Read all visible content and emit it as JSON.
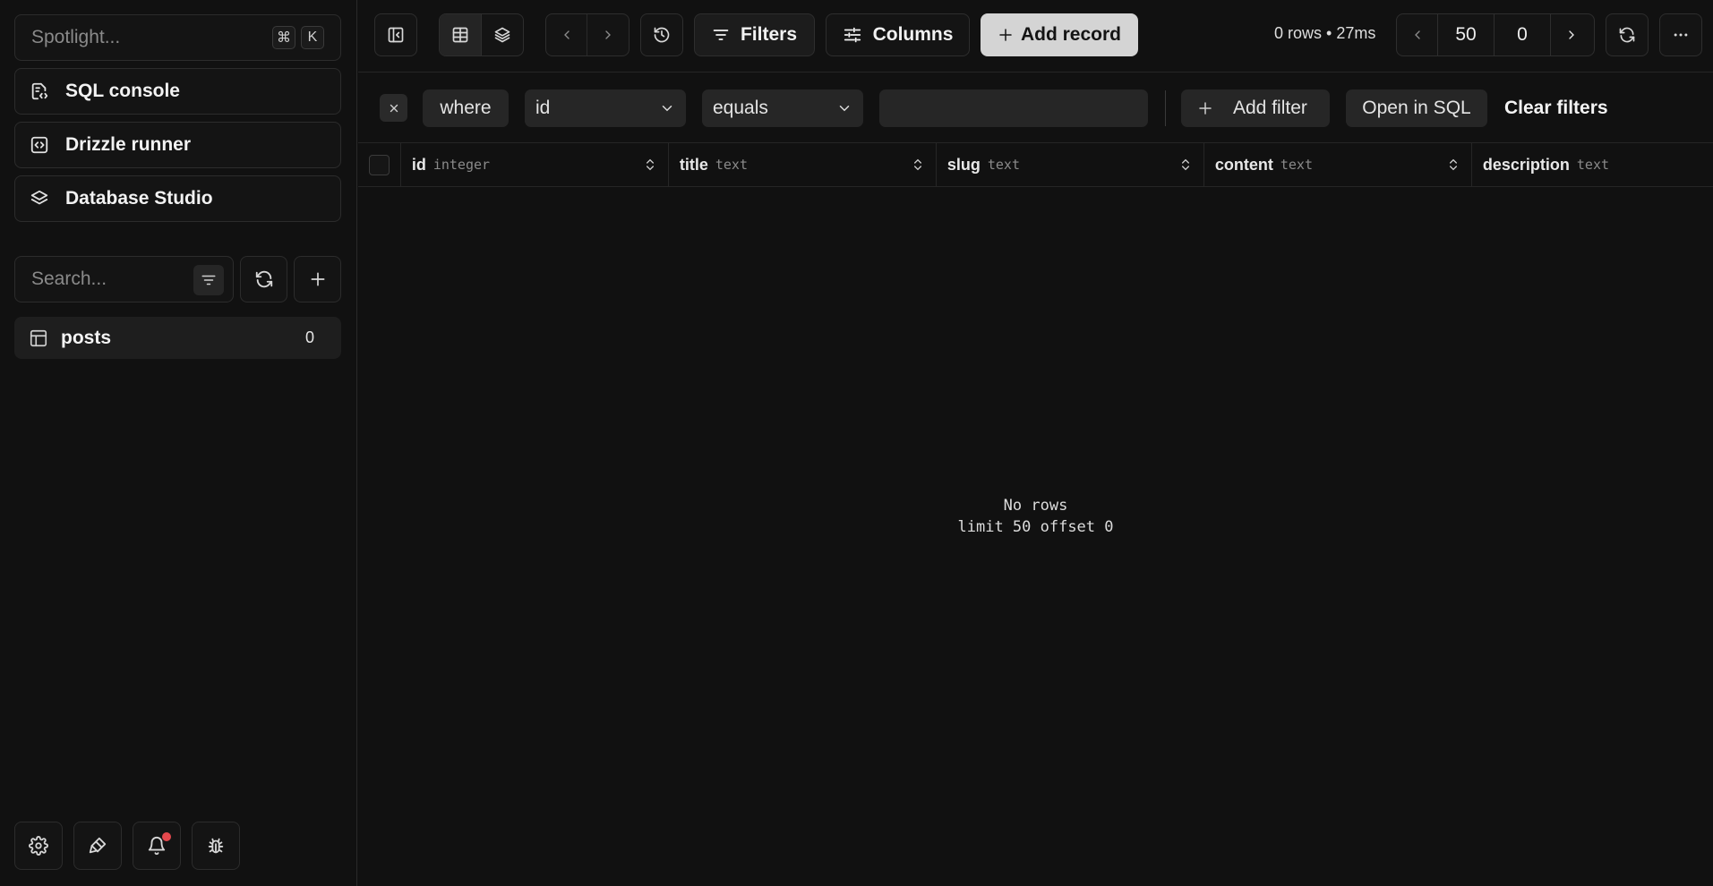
{
  "sidebar": {
    "spotlight": {
      "placeholder": "Spotlight...",
      "kbd_mod": "⌘",
      "kbd_key": "K"
    },
    "nav": {
      "sql_console": "SQL console",
      "drizzle_runner": "Drizzle runner",
      "database_studio": "Database Studio"
    },
    "search": {
      "placeholder": "Search..."
    },
    "tables": [
      {
        "name": "posts",
        "count": "0"
      }
    ],
    "footer_icons": [
      "gear-icon",
      "brush-icon",
      "bell-icon",
      "bug-icon"
    ]
  },
  "toolbar": {
    "filters_label": "Filters",
    "columns_label": "Columns",
    "add_record_label": "Add record",
    "rows_info": "0 rows • 27ms",
    "limit": "50",
    "offset": "0"
  },
  "filter": {
    "where_label": "where",
    "column": "id",
    "operator": "equals",
    "value": "",
    "add_filter_label": "Add filter",
    "open_sql_label": "Open in SQL",
    "clear_label": "Clear filters"
  },
  "grid": {
    "columns": [
      {
        "name": "id",
        "type": "integer"
      },
      {
        "name": "title",
        "type": "text"
      },
      {
        "name": "slug",
        "type": "text"
      },
      {
        "name": "content",
        "type": "text"
      },
      {
        "name": "description",
        "type": "text"
      }
    ],
    "empty_title": "No rows",
    "empty_subtitle": "limit 50 offset 0"
  },
  "colors": {
    "background": "#111111",
    "accent_button": "#d4d4d4",
    "notification_dot": "#e5484d"
  }
}
